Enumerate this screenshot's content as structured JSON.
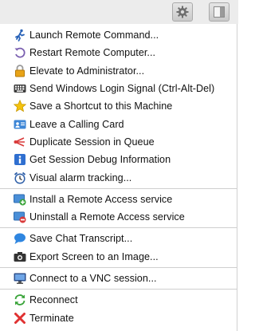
{
  "toolbar": {
    "buttons": [
      {
        "icon": "gear-icon"
      },
      {
        "icon": "panel-toggle-icon"
      }
    ]
  },
  "menu": {
    "items": [
      {
        "label": "Launch Remote Command...",
        "icon": "running-person-icon"
      },
      {
        "label": "Restart Remote Computer...",
        "icon": "restart-icon"
      },
      {
        "label": "Elevate to Administrator...",
        "icon": "padlock-icon"
      },
      {
        "label": "Send Windows Login Signal (Ctrl-Alt-Del)",
        "icon": "keyboard-icon"
      },
      {
        "label": "Save a Shortcut to this Machine",
        "icon": "star-icon"
      },
      {
        "label": "Leave a Calling Card",
        "icon": "calling-card-icon"
      },
      {
        "label": "Duplicate Session in Queue",
        "icon": "duplicate-icon"
      },
      {
        "label": "Get Session Debug Information",
        "icon": "info-icon"
      },
      {
        "label": "Visual alarm tracking...",
        "icon": "alarm-clock-icon"
      },
      {
        "label": "Install a Remote Access service",
        "icon": "install-service-icon"
      },
      {
        "label": "Uninstall a Remote Access service",
        "icon": "uninstall-service-icon"
      },
      {
        "label": "Save Chat Transcript...",
        "icon": "chat-bubble-icon"
      },
      {
        "label": "Export Screen to an Image...",
        "icon": "camera-icon"
      },
      {
        "label": "Connect to a VNC session...",
        "icon": "monitor-icon"
      },
      {
        "label": "Reconnect",
        "icon": "reconnect-icon"
      },
      {
        "label": "Terminate",
        "icon": "terminate-icon"
      }
    ]
  },
  "colors": {
    "toolbar_bg": "#ececec",
    "separator": "#cfcfcf",
    "text": "#111111"
  }
}
